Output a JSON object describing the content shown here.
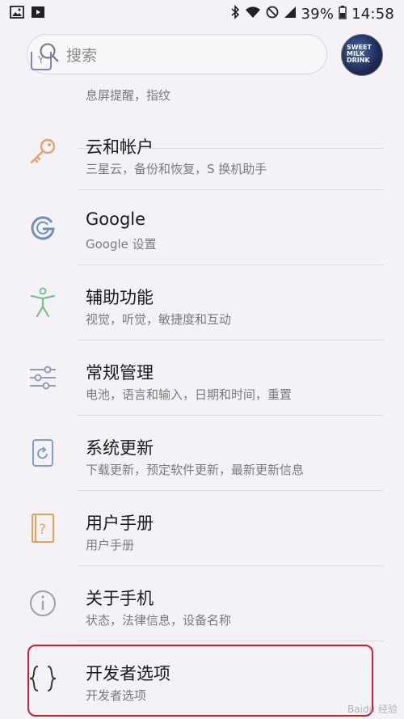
{
  "status_bar": {
    "battery_percent": "39%",
    "time": "14:58",
    "icons": [
      "image-icon",
      "video-icon",
      "bluetooth-icon",
      "wifi-icon",
      "dnd-icon",
      "signal-icon",
      "battery-icon"
    ]
  },
  "search": {
    "placeholder": "搜索"
  },
  "avatar": {
    "text": "SWEET\nMILK\nDRINK"
  },
  "items": [
    {
      "title": "",
      "subtitle": "息屏提醒，指纹",
      "icon": "lock-screen-icon"
    },
    {
      "title": "云和帐户",
      "subtitle": "三星云，备份和恢复，S 换机助手",
      "icon": "key-icon"
    },
    {
      "title": "Google",
      "subtitle": "Google 设置",
      "icon": "google-icon"
    },
    {
      "title": "辅助功能",
      "subtitle": "视觉，听觉，敏捷度和互动",
      "icon": "accessibility-icon"
    },
    {
      "title": "常规管理",
      "subtitle": "电池，语言和输入，日期和时间，重置",
      "icon": "sliders-icon"
    },
    {
      "title": "系统更新",
      "subtitle": "下载更新，预定软件更新，最新更新信息",
      "icon": "system-update-icon"
    },
    {
      "title": "用户手册",
      "subtitle": "用户手册",
      "icon": "user-manual-icon"
    },
    {
      "title": "关于手机",
      "subtitle": "状态，法律信息，设备名称",
      "icon": "info-icon"
    },
    {
      "title": "开发者选项",
      "subtitle": "开发者选项",
      "icon": "braces-icon"
    }
  ],
  "watermark": "Baidu 经验",
  "colors": {
    "background": "#f4f2f6",
    "highlight_border": "#c8202e",
    "key_icon": "#e3a36b",
    "google_icon": "#6f8fbf",
    "accessibility_icon": "#7cc08a",
    "sliders_icon": "#8f9fb0",
    "update_icon": "#7f9fc9",
    "manual_icon": "#e2a35a",
    "info_icon": "#9aa3ad"
  }
}
